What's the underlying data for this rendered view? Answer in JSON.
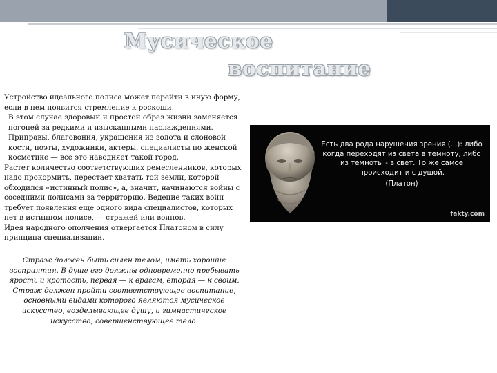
{
  "title": {
    "line1": "Мусическое",
    "line2": "воспитание"
  },
  "body_paragraphs": [
    "Устройство идеального полиса может перейти в иную форму, если в нем появится стремление к роскоши.",
    "В этом случае здоровый и простой образ жизни заменяется погоней за редкими и изысканными наслаждениями. Приправы, благовония, украшения из золота и слоновой кости, поэты, художники, актеры, специалисты по женской косметике — все это наводняет такой город.",
    "Растет количество соответствующих ремесленников, которых надо прокормить, перестает хватать той земли, которой обходился «истинный полис», а, значит, начинаются войны с соседними полисами за территорию. Ведение таких войн требует появления еще одного вида специалистов, которых нет в истинном полисе, — стражей или воинов.",
    "Идея народного ополчения отвергается Платоном в силу принципа специализации."
  ],
  "italic_text": "Страж должен быть силен телом, иметь хорошие восприятия. В душе его должны одновременно пребывать ярость и кротость, первая — к врагам, вторая — к своим. Страж должен пройти соответствующее воспитание, основными видами которого являются мусическое искусство, возделывающее душу, и гимнастическое искусство, совершенствующее тело.",
  "quote_card": {
    "quote": "Есть два рода нарушения зрения (...): либо когда переходят из света в темноту, либо из темноты - в свет. То же самое происходит и с душой.",
    "author": "(Платон)",
    "watermark": "fakty.com"
  },
  "colors": {
    "band_dark": "#3b4b5c",
    "band_grey": "#9aa3ad",
    "title_fill": "#e6e9ec",
    "card_bg": "#050505"
  }
}
